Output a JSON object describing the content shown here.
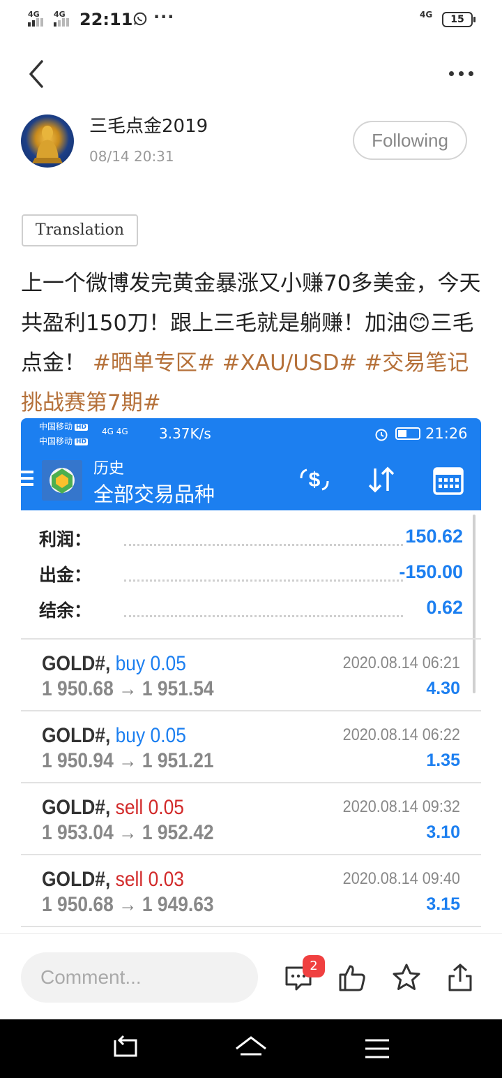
{
  "status_bar": {
    "net1": "4G",
    "net2": "4G",
    "time": "22:11",
    "notif_icon": "whatsapp-icon",
    "more": "···",
    "net_right": "4G",
    "battery": "15"
  },
  "nav": {
    "back_icon": "chevron-left-icon",
    "more_icon": "more-dots-icon"
  },
  "author": {
    "name": "三毛点金2019",
    "time": "08/14 20:31",
    "follow_label": "Following"
  },
  "translation_label": "Translation",
  "post": {
    "text": "上一个微博发完黄金暴涨又小赚70多美金，今天共盈利150刀！跟上三毛就是躺赚！加油😊三毛点金！",
    "tags": [
      "#晒单专区#",
      "#XAU/USD#",
      "#交易笔记挑战赛第7期#"
    ]
  },
  "embedded_screenshot": {
    "status": {
      "carrier1": "中国移动",
      "carrier2": "中国移动",
      "hd": "HD",
      "signal": "4G 4G",
      "speed": "3.37K/s",
      "time": "21:26"
    },
    "header": {
      "title_small": "历史",
      "title_big": "全部交易品种"
    },
    "summary": [
      {
        "label": "利润：",
        "value": "150.62"
      },
      {
        "label": "出金：",
        "value": "-150.00"
      },
      {
        "label": "结余：",
        "value": "0.62"
      }
    ],
    "trades": [
      {
        "symbol": "GOLD#,",
        "side": "buy",
        "volume": "0.05",
        "prices": "1 950.68 → 1 951.54",
        "date": "2020.08.14 06:21",
        "profit": "4.30"
      },
      {
        "symbol": "GOLD#,",
        "side": "buy",
        "volume": "0.05",
        "prices": "1 950.94 → 1 951.21",
        "date": "2020.08.14 06:22",
        "profit": "1.35"
      },
      {
        "symbol": "GOLD#,",
        "side": "sell",
        "volume": "0.05",
        "prices": "1 953.04 → 1 952.42",
        "date": "2020.08.14 09:32",
        "profit": "3.10"
      },
      {
        "symbol": "GOLD#,",
        "side": "sell",
        "volume": "0.03",
        "prices": "1 950.68 → 1 949.63",
        "date": "2020.08.14 09:40",
        "profit": "3.15"
      }
    ]
  },
  "comment_bar": {
    "placeholder": "Comment...",
    "comment_count": "2"
  },
  "colors": {
    "accent_blue": "#1c7ff0",
    "sell_red": "#d22a2a",
    "tag_brown": "#b5713a",
    "badge_red": "#f04040"
  }
}
